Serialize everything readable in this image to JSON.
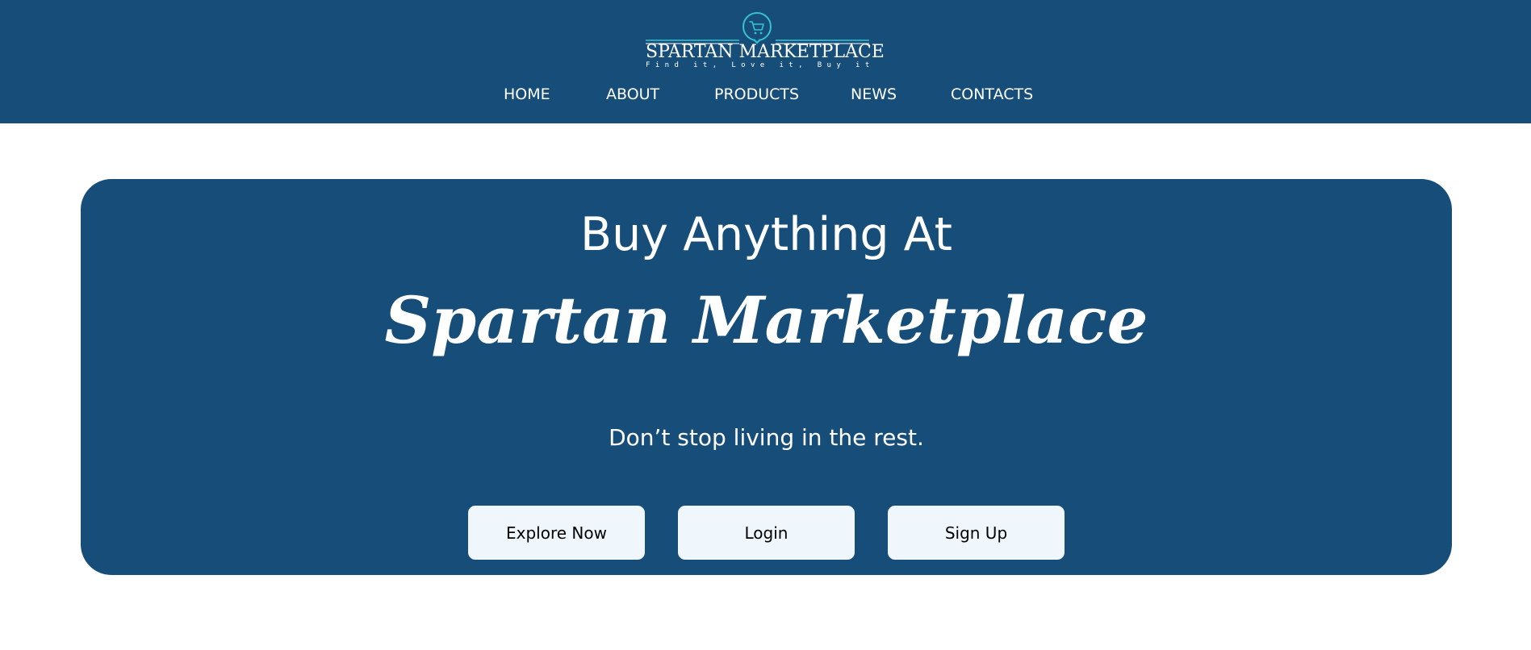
{
  "colors": {
    "primary": "#174e79",
    "accent": "#35c2d1",
    "button_bg": "#eff6fc",
    "text_light": "#ffffff",
    "text_dark": "#000000"
  },
  "header": {
    "logo": {
      "icon": "shopping-cart-icon",
      "title": "SPARTAN MARKETPLACE",
      "tagline": "Find it, Love it, Buy it"
    },
    "nav": {
      "items": [
        {
          "label": "HOME"
        },
        {
          "label": "ABOUT"
        },
        {
          "label": "PRODUCTS"
        },
        {
          "label": "NEWS"
        },
        {
          "label": "CONTACTS"
        }
      ]
    }
  },
  "hero": {
    "lead": "Buy Anything At",
    "brand": "Spartan Marketplace",
    "tagline": "Don’t stop living in the rest.",
    "buttons": [
      {
        "label": "Explore Now"
      },
      {
        "label": "Login"
      },
      {
        "label": "Sign Up"
      }
    ]
  }
}
